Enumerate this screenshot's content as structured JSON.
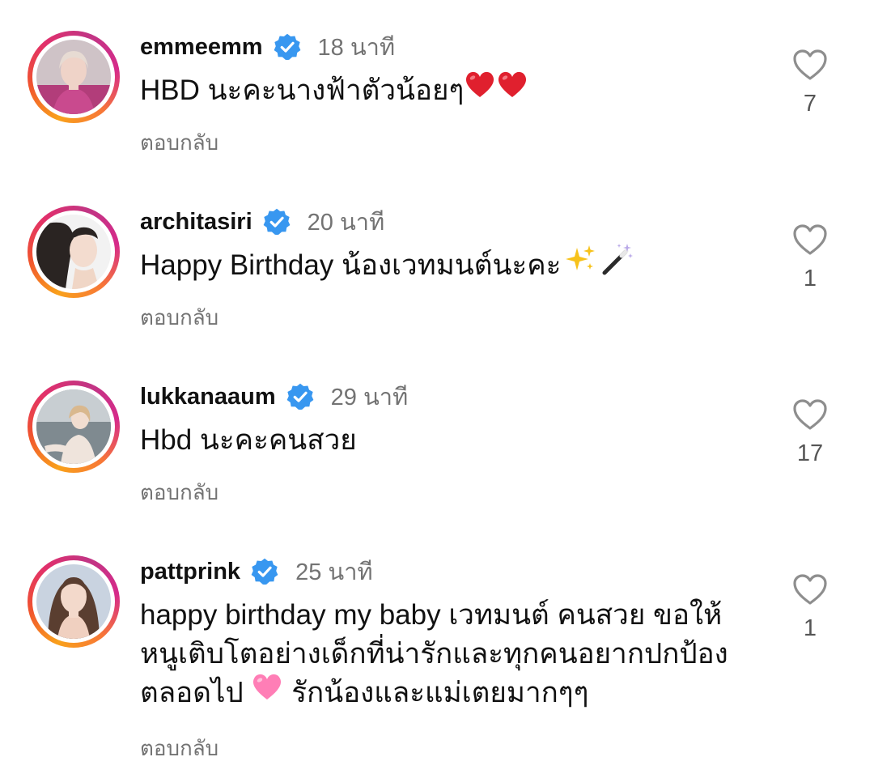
{
  "comments": [
    {
      "username": "emmeemm",
      "time": "18 นาที",
      "text": "HBD นะคะนางฟ้าตัวน้อยๆ",
      "reply": "ตอบกลับ",
      "likes": "7"
    },
    {
      "username": "architasiri",
      "time": "20 นาที",
      "text": "Happy Birthday น้องเวทมนต์นะคะ",
      "reply": "ตอบกลับ",
      "likes": "1"
    },
    {
      "username": "lukkanaaum",
      "time": "29 นาที",
      "text": "Hbd นะคะคนสวย",
      "reply": "ตอบกลับ",
      "likes": "17"
    },
    {
      "username": "pattprink",
      "time": "25 นาที",
      "text_line1": "happy birthday my baby เวทมนต์ คนสวย ขอให้",
      "text_line2": "หนูเติบโตอย่างเด็กที่น่ารักและทุกคนอยากปกป้อง",
      "text_line3a": "ตลอดไป",
      "text_line3b": "รักน้องและแม่เตยมากๆๆ",
      "reply": "ตอบกลับ",
      "likes": "1"
    }
  ],
  "colors": {
    "verified": "#3897f0",
    "meta_text": "#737373",
    "heart_red": "#e0202e",
    "heart_pink": "#ff7eb6"
  },
  "icons": {
    "verified": "verified-badge-icon",
    "like": "heart-outline-icon",
    "emoji_heart": "red-heart-emoji",
    "emoji_sparkles": "sparkles-emoji",
    "emoji_wand": "magic-wand-emoji",
    "emoji_pink_heart": "pink-heart-emoji"
  }
}
